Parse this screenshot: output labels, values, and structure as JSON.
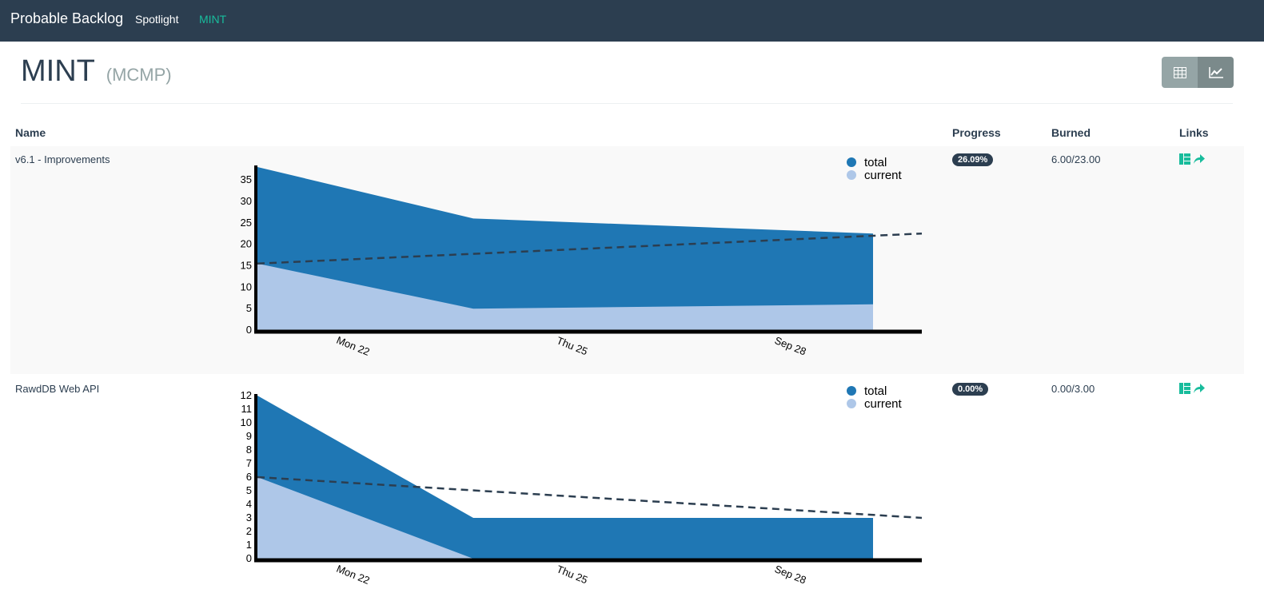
{
  "nav": {
    "brand": "Probable Backlog",
    "links": [
      "Spotlight",
      "MINT"
    ]
  },
  "page": {
    "title": "MINT",
    "subtitle": "(MCMP)"
  },
  "colors": {
    "navbar": "#2c3e50",
    "accent": "#18bc9c",
    "total": "#1f77b4",
    "current": "#aec7e8"
  },
  "table": {
    "headers": [
      "Name",
      "Progress",
      "Burned",
      "Links"
    ],
    "rows": [
      {
        "name": "v6.1 - Improvements",
        "progress": "26.09%",
        "burned": "6.00/23.00"
      },
      {
        "name": "RawdDB Web API",
        "progress": "0.00%",
        "burned": "0.00/3.00"
      }
    ]
  },
  "chart_data": [
    {
      "type": "area",
      "x": [
        "Mon 22",
        "Thu 25",
        "Sep 28"
      ],
      "series": [
        {
          "name": "total",
          "values": [
            38,
            26,
            22.5
          ]
        },
        {
          "name": "current",
          "values": [
            15.5,
            5,
            6
          ]
        }
      ],
      "trend": [
        15.5,
        22.5
      ],
      "yticks": [
        0,
        5,
        10,
        15,
        20,
        25,
        30,
        35
      ],
      "ylim": [
        0,
        38
      ],
      "legend": "top-right"
    },
    {
      "type": "area",
      "x": [
        "Mon 22",
        "Thu 25",
        "Sep 28"
      ],
      "series": [
        {
          "name": "total",
          "values": [
            12,
            3,
            3
          ]
        },
        {
          "name": "current",
          "values": [
            6,
            0,
            0
          ]
        }
      ],
      "trend": [
        6,
        3
      ],
      "yticks": [
        0,
        1,
        2,
        3,
        4,
        5,
        6,
        7,
        8,
        9,
        10,
        11,
        12
      ],
      "ylim": [
        0,
        12
      ],
      "legend": "top-right"
    }
  ]
}
